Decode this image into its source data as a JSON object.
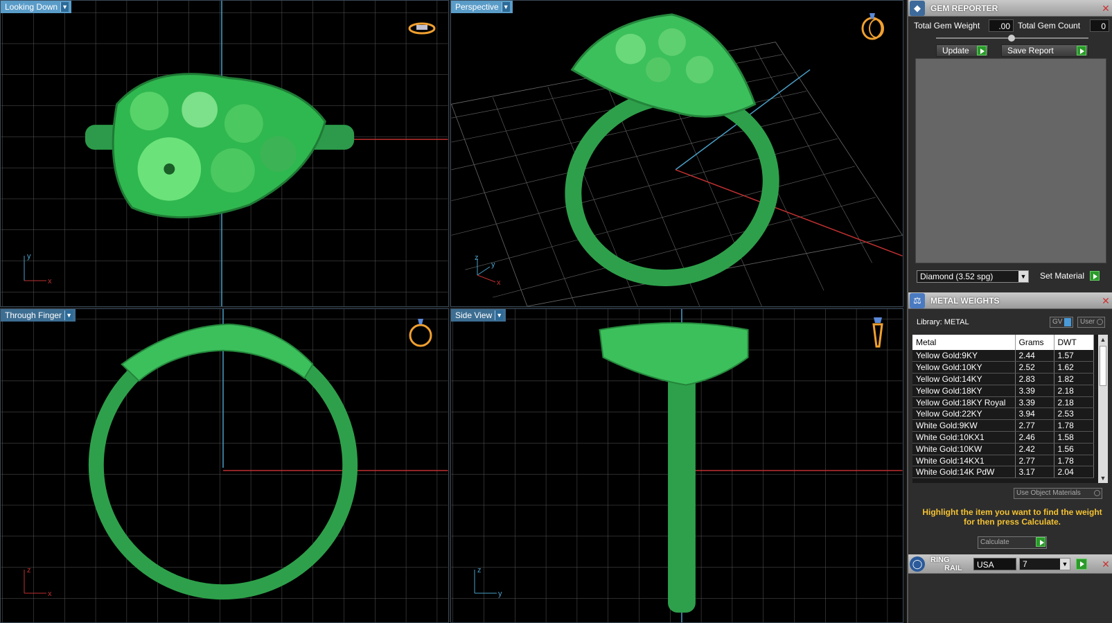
{
  "viewports": {
    "top_left": {
      "label": "Looking Down"
    },
    "top_right": {
      "label": "Perspective"
    },
    "bottom_left": {
      "label": "Through Finger"
    },
    "bottom_right": {
      "label": "Side View"
    }
  },
  "axes": {
    "top_left": {
      "v": "y",
      "h": "x"
    },
    "top_right": {
      "v": "z",
      "h": "y",
      "d": "x"
    },
    "bottom_left": {
      "v": "z",
      "h": "x"
    },
    "bottom_right": {
      "v": "z",
      "h": "y"
    }
  },
  "gem_reporter": {
    "title": "GEM REPORTER",
    "total_weight_label": "Total Gem Weight",
    "total_weight_value": ".00",
    "total_count_label": "Total Gem Count",
    "total_count_value": "0",
    "update_label": "Update",
    "save_report_label": "Save Report",
    "material_select": "Diamond    (3.52 spg)",
    "set_material_label": "Set Material"
  },
  "metal_weights": {
    "title": "METAL WEIGHTS",
    "library_label": "Library: METAL",
    "gv_label": "GV",
    "user_label": "User",
    "columns": [
      "Metal",
      "Grams",
      "DWT"
    ],
    "rows": [
      [
        "Yellow Gold:9KY",
        "2.44",
        "1.57"
      ],
      [
        "Yellow Gold:10KY",
        "2.52",
        "1.62"
      ],
      [
        "Yellow Gold:14KY",
        "2.83",
        "1.82"
      ],
      [
        "Yellow Gold:18KY",
        "3.39",
        "2.18"
      ],
      [
        "Yellow Gold:18KY Royal",
        "3.39",
        "2.18"
      ],
      [
        "Yellow Gold:22KY",
        "3.94",
        "2.53"
      ],
      [
        "White Gold:9KW",
        "2.77",
        "1.78"
      ],
      [
        "White Gold:10KX1",
        "2.46",
        "1.58"
      ],
      [
        "White Gold:10KW",
        "2.42",
        "1.56"
      ],
      [
        "White Gold:14KX1",
        "2.77",
        "1.78"
      ],
      [
        "White Gold:14K PdW",
        "3.17",
        "2.04"
      ]
    ],
    "use_object_materials_label": "Use Object Materials",
    "hint": "Highlight the item you want to find the weight for then press Calculate.",
    "calculate_label": "Calculate"
  },
  "ring_rail": {
    "title_line1": "RING",
    "title_line2": "RAIL",
    "country": "USA",
    "size": "7"
  }
}
